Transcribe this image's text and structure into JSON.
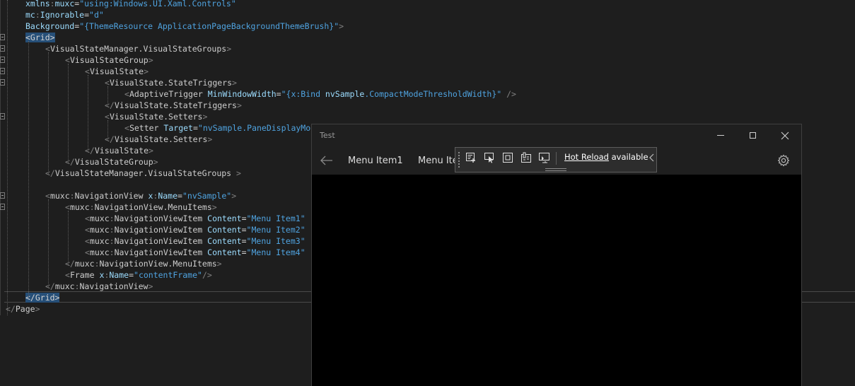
{
  "editor": {
    "lines": [
      {
        "indent": 36,
        "fold": false,
        "segments": [
          [
            "att",
            "xmlns"
          ],
          [
            "br",
            ":"
          ],
          [
            "att",
            "muxc"
          ],
          [
            "txt",
            "="
          ],
          [
            "str",
            "\"using:Windows.UI.Xaml.Controls\""
          ]
        ]
      },
      {
        "indent": 36,
        "fold": false,
        "segments": [
          [
            "att",
            "mc"
          ],
          [
            "br",
            ":"
          ],
          [
            "att",
            "Ignorable"
          ],
          [
            "txt",
            "="
          ],
          [
            "str",
            "\"d\""
          ]
        ]
      },
      {
        "indent": 36,
        "fold": false,
        "segments": [
          [
            "att",
            "Background"
          ],
          [
            "txt",
            "="
          ],
          [
            "str",
            "\"{ThemeResource ApplicationPageBackgroundThemeBrush}\""
          ],
          [
            "br",
            ">"
          ]
        ]
      },
      {
        "indent": 36,
        "fold": true,
        "segments": [
          [
            "hl",
            "<Grid>"
          ]
        ]
      },
      {
        "indent": 64,
        "fold": true,
        "segments": [
          [
            "br",
            "<"
          ],
          [
            "tag",
            "VisualStateManager.VisualStateGroups"
          ],
          [
            "br",
            ">"
          ]
        ]
      },
      {
        "indent": 92,
        "fold": true,
        "segments": [
          [
            "br",
            "<"
          ],
          [
            "tag",
            "VisualStateGroup"
          ],
          [
            "br",
            ">"
          ]
        ]
      },
      {
        "indent": 120,
        "fold": true,
        "segments": [
          [
            "br",
            "<"
          ],
          [
            "tag",
            "VisualState"
          ],
          [
            "br",
            ">"
          ]
        ]
      },
      {
        "indent": 148,
        "fold": true,
        "segments": [
          [
            "br",
            "<"
          ],
          [
            "tag",
            "VisualState.StateTriggers"
          ],
          [
            "br",
            ">"
          ]
        ]
      },
      {
        "indent": 176,
        "fold": false,
        "segments": [
          [
            "br",
            "<"
          ],
          [
            "tag",
            "AdaptiveTrigger"
          ],
          [
            "txt",
            " "
          ],
          [
            "att",
            "MinWindowWidth"
          ],
          [
            "txt",
            "="
          ],
          [
            "str",
            "\"{x:Bind "
          ],
          [
            "att",
            "nvSample"
          ],
          [
            "str",
            ".CompactModeThresholdWidth}\""
          ],
          [
            "br",
            " />"
          ]
        ]
      },
      {
        "indent": 148,
        "fold": false,
        "segments": [
          [
            "br",
            "</"
          ],
          [
            "tag",
            "VisualState.StateTriggers"
          ],
          [
            "br",
            ">"
          ]
        ]
      },
      {
        "indent": 148,
        "fold": true,
        "segments": [
          [
            "br",
            "<"
          ],
          [
            "tag",
            "VisualState.Setters"
          ],
          [
            "br",
            ">"
          ]
        ]
      },
      {
        "indent": 176,
        "fold": false,
        "segments": [
          [
            "br",
            "<"
          ],
          [
            "tag",
            "Setter"
          ],
          [
            "txt",
            " "
          ],
          [
            "att",
            "Target"
          ],
          [
            "txt",
            "="
          ],
          [
            "str",
            "\"nvSample.PaneDisplayMo"
          ]
        ]
      },
      {
        "indent": 148,
        "fold": false,
        "segments": [
          [
            "br",
            "</"
          ],
          [
            "tag",
            "VisualState.Setters"
          ],
          [
            "br",
            ">"
          ]
        ]
      },
      {
        "indent": 120,
        "fold": false,
        "segments": [
          [
            "br",
            "</"
          ],
          [
            "tag",
            "VisualState"
          ],
          [
            "br",
            ">"
          ]
        ]
      },
      {
        "indent": 92,
        "fold": false,
        "segments": [
          [
            "br",
            "</"
          ],
          [
            "tag",
            "VisualStateGroup"
          ],
          [
            "br",
            ">"
          ]
        ]
      },
      {
        "indent": 64,
        "fold": false,
        "segments": [
          [
            "br",
            "</"
          ],
          [
            "tag",
            "VisualStateManager.VisualStateGroups"
          ],
          [
            "br",
            " >"
          ]
        ]
      },
      {
        "indent": 64,
        "fold": false,
        "segments": []
      },
      {
        "indent": 64,
        "fold": true,
        "segments": [
          [
            "br",
            "<"
          ],
          [
            "tag",
            "muxc"
          ],
          [
            "br",
            ":"
          ],
          [
            "tag",
            "NavigationView"
          ],
          [
            "txt",
            " "
          ],
          [
            "att",
            "x"
          ],
          [
            "br",
            ":"
          ],
          [
            "att",
            "Name"
          ],
          [
            "txt",
            "="
          ],
          [
            "str",
            "\"nvSample\""
          ],
          [
            "br",
            ">"
          ]
        ]
      },
      {
        "indent": 92,
        "fold": true,
        "segments": [
          [
            "br",
            "<"
          ],
          [
            "tag",
            "muxc"
          ],
          [
            "br",
            ":"
          ],
          [
            "tag",
            "NavigationView.MenuItems"
          ],
          [
            "br",
            ">"
          ]
        ]
      },
      {
        "indent": 120,
        "fold": false,
        "segments": [
          [
            "br",
            "<"
          ],
          [
            "tag",
            "muxc"
          ],
          [
            "br",
            ":"
          ],
          [
            "tag",
            "NavigationViewItem"
          ],
          [
            "txt",
            " "
          ],
          [
            "att",
            "Content"
          ],
          [
            "txt",
            "="
          ],
          [
            "str",
            "\"Menu Item1\""
          ]
        ]
      },
      {
        "indent": 120,
        "fold": false,
        "segments": [
          [
            "br",
            "<"
          ],
          [
            "tag",
            "muxc"
          ],
          [
            "br",
            ":"
          ],
          [
            "tag",
            "NavigationViewItem"
          ],
          [
            "txt",
            " "
          ],
          [
            "att",
            "Content"
          ],
          [
            "txt",
            "="
          ],
          [
            "str",
            "\"Menu Item2\""
          ]
        ]
      },
      {
        "indent": 120,
        "fold": false,
        "segments": [
          [
            "br",
            "<"
          ],
          [
            "tag",
            "muxc"
          ],
          [
            "br",
            ":"
          ],
          [
            "tag",
            "NavigationViewItem"
          ],
          [
            "txt",
            " "
          ],
          [
            "att",
            "Content"
          ],
          [
            "txt",
            "="
          ],
          [
            "str",
            "\"Menu Item3\""
          ]
        ]
      },
      {
        "indent": 120,
        "fold": false,
        "segments": [
          [
            "br",
            "<"
          ],
          [
            "tag",
            "muxc"
          ],
          [
            "br",
            ":"
          ],
          [
            "tag",
            "NavigationViewItem"
          ],
          [
            "txt",
            " "
          ],
          [
            "att",
            "Content"
          ],
          [
            "txt",
            "="
          ],
          [
            "str",
            "\"Menu Item4\""
          ]
        ]
      },
      {
        "indent": 92,
        "fold": false,
        "segments": [
          [
            "br",
            "</"
          ],
          [
            "tag",
            "muxc"
          ],
          [
            "br",
            ":"
          ],
          [
            "tag",
            "NavigationView.MenuItems"
          ],
          [
            "br",
            ">"
          ]
        ]
      },
      {
        "indent": 92,
        "fold": false,
        "segments": [
          [
            "br",
            "<"
          ],
          [
            "tag",
            "Frame"
          ],
          [
            "txt",
            " "
          ],
          [
            "att",
            "x"
          ],
          [
            "br",
            ":"
          ],
          [
            "att",
            "Name"
          ],
          [
            "txt",
            "="
          ],
          [
            "str",
            "\"contentFrame\""
          ],
          [
            "br",
            "/>"
          ]
        ]
      },
      {
        "indent": 64,
        "fold": false,
        "segments": [
          [
            "br",
            "</"
          ],
          [
            "tag",
            "muxc"
          ],
          [
            "br",
            ":"
          ],
          [
            "tag",
            "NavigationView"
          ],
          [
            "br",
            ">"
          ]
        ]
      },
      {
        "indent": 36,
        "fold": false,
        "segments": [
          [
            "hl",
            "</Grid>"
          ]
        ]
      },
      {
        "indent": 8,
        "fold": false,
        "segments": [
          [
            "br",
            "</"
          ],
          [
            "tag",
            "Page"
          ],
          [
            "br",
            ">"
          ]
        ]
      }
    ]
  },
  "app": {
    "title": "Test",
    "nav_items": [
      "Menu Item1",
      "Menu Ite"
    ],
    "icons": {
      "back": "back-arrow-icon",
      "settings": "gear-icon",
      "minimize": "minimize-icon",
      "maximize": "maximize-icon",
      "close": "close-icon"
    }
  },
  "toolbar": {
    "hot_reload_link": "Hot Reload",
    "hot_reload_status": " available",
    "icons": [
      "live-visual-tree-icon",
      "select-element-icon",
      "display-layout-adorners-icon",
      "track-focus-icon",
      "hot-reload-sync-icon",
      "collapse-chevron-icon"
    ]
  },
  "colors": {
    "editor_bg": "#1e1e1e",
    "app_bg": "#000000",
    "titlebar_bg": "#1f1f1f",
    "toolbar_bg": "#2d2d2d",
    "attribute": "#9cdcfe",
    "string": "#4fa3e0",
    "selection": "#264f78"
  }
}
